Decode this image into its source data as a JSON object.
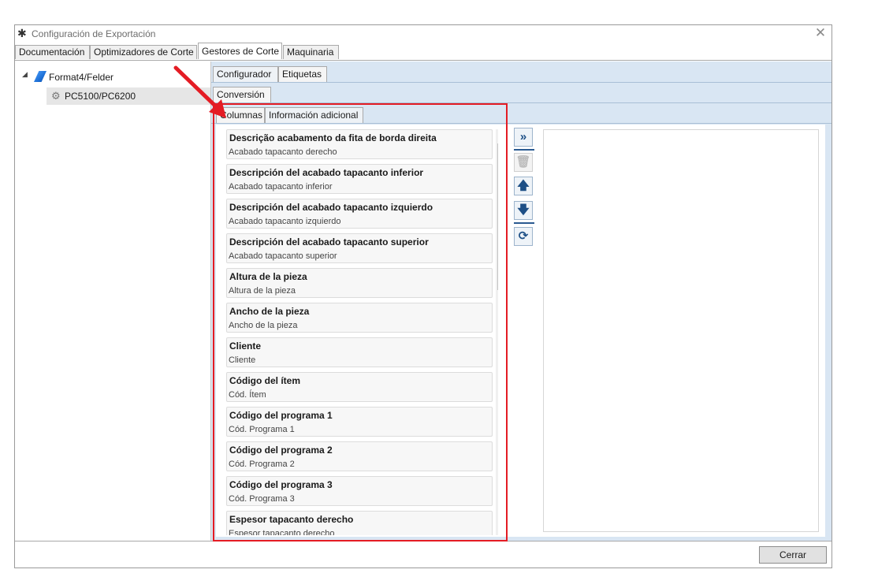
{
  "window": {
    "title": "Configuración de Exportación",
    "close_glyph": "✕",
    "gear_glyph": "✱"
  },
  "main_tabs": [
    {
      "label": "Documentación"
    },
    {
      "label": "Optimizadores de Corte"
    },
    {
      "label": "Gestores de Corte"
    },
    {
      "label": "Maquinaria"
    }
  ],
  "tree": {
    "root": "Format4/Felder",
    "child": "PC5100/PC6200",
    "expand_glyph": "◢"
  },
  "sub_tabs": {
    "level1": [
      "Configurador",
      "Etiquetas"
    ],
    "level2": [
      "Conversión"
    ],
    "level3": [
      "Columnas",
      "Información adicional"
    ]
  },
  "columns_list": [
    {
      "title": "Descrição acabamento da fita de borda direita",
      "subtitle": "Acabado tapacanto derecho"
    },
    {
      "title": "Descripción del acabado tapacanto inferior",
      "subtitle": "Acabado tapacanto inferior"
    },
    {
      "title": "Descripción del acabado tapacanto izquierdo",
      "subtitle": "Acabado tapacanto izquierdo"
    },
    {
      "title": "Descripción del acabado tapacanto superior",
      "subtitle": "Acabado tapacanto superior"
    },
    {
      "title": "Altura de la pieza",
      "subtitle": "Altura de la pieza"
    },
    {
      "title": "Ancho de la pieza",
      "subtitle": "Ancho de la pieza"
    },
    {
      "title": "Cliente",
      "subtitle": "Cliente"
    },
    {
      "title": "Código del ítem",
      "subtitle": "Cód. Ítem"
    },
    {
      "title": "Código del programa 1",
      "subtitle": "Cód. Programa 1"
    },
    {
      "title": "Código del programa 2",
      "subtitle": "Cód. Programa 2"
    },
    {
      "title": "Código del programa 3",
      "subtitle": "Cód. Programa 3"
    },
    {
      "title": "Espesor tapacanto derecho",
      "subtitle": "Espesor tapacanto derecho"
    }
  ],
  "toolbar": {
    "add_all": "»",
    "delete": "🗑",
    "move_up": "🡅",
    "move_down": "🡇",
    "reset": "⟳"
  },
  "scroll": {
    "up": "⌃",
    "down": "⌄"
  },
  "footer": {
    "close_label": "Cerrar"
  },
  "colors": {
    "highlight": "#e41c24",
    "panel_bg": "#d9e6f3",
    "accent": "#1d4f86"
  }
}
